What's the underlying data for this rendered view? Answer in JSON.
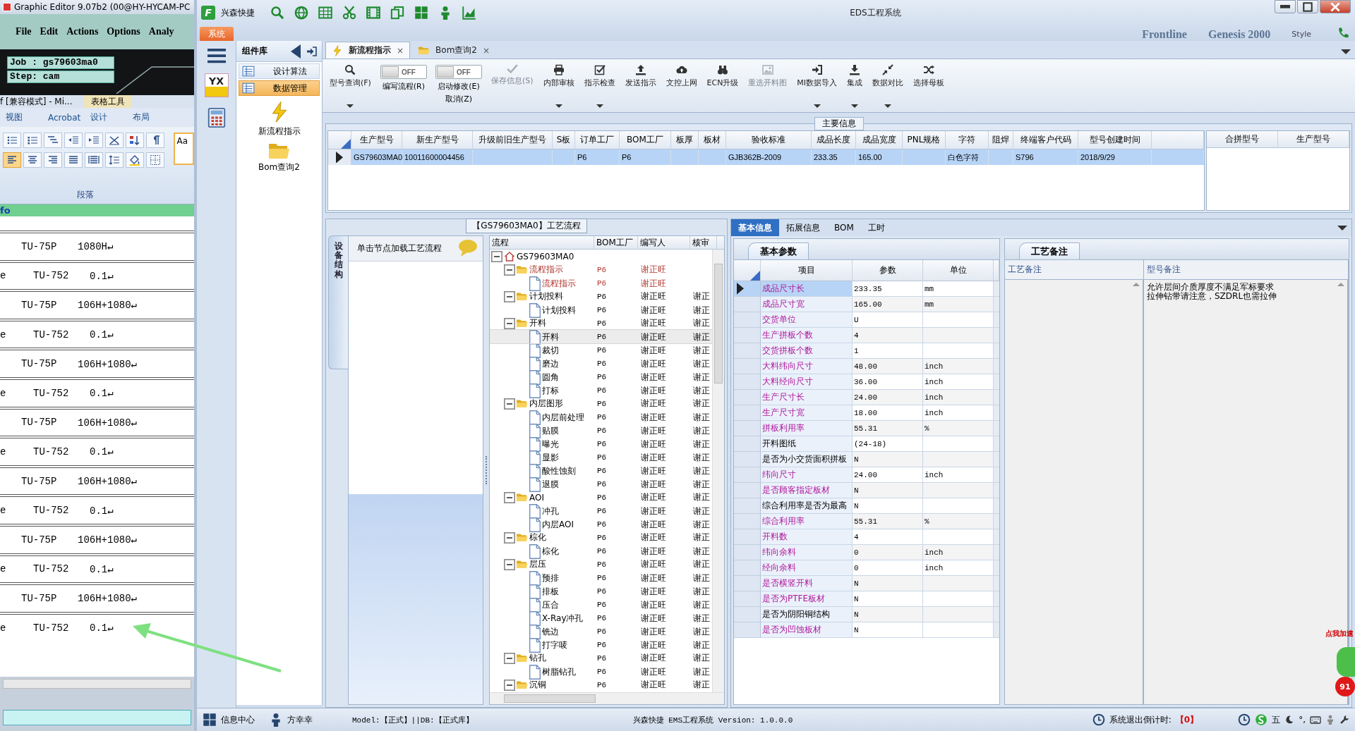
{
  "graphic_editor": {
    "title": "Graphic Editor 9.07b2 (00@HY-HYCAM-PC",
    "menu": [
      "File",
      "Edit",
      "Actions",
      "Options",
      "Analy"
    ],
    "job": "Job : gs79603ma0",
    "step": "Step: cam"
  },
  "word": {
    "title": "f [兼容模式] - Mi...",
    "context_tab": "表格工具",
    "tabs": [
      "视图",
      "Acrobat",
      "设计",
      "布局"
    ],
    "style_preview": "Aa",
    "group_label": "段落",
    "header_text": "fo",
    "lines": [
      {
        "code": "TU-75P",
        "value": "1080H↵"
      },
      {
        "prefix": "e",
        "code": "TU-752",
        "value": "0.1↵"
      },
      {
        "code": "TU-75P",
        "value": "106H+1080↵"
      },
      {
        "prefix": "e",
        "code": "TU-752",
        "value": "0.1↵"
      },
      {
        "code": "TU-75P",
        "value": "106H+1080↵"
      },
      {
        "prefix": "e",
        "code": "TU-752",
        "value": "0.1↵"
      },
      {
        "code": "TU-75P",
        "value": "106H+1080↵"
      },
      {
        "prefix": "e",
        "code": "TU-752",
        "value": "0.1↵"
      },
      {
        "code": "TU-75P",
        "value": "106H+1080↵"
      },
      {
        "prefix": "e",
        "code": "TU-752",
        "value": "0.1↵"
      },
      {
        "code": "TU-75P",
        "value": "106H+1080↵"
      },
      {
        "prefix": "e",
        "code": "TU-752",
        "value": "0.1↵"
      },
      {
        "code": "TU-75P",
        "value": "106H+1080↵"
      },
      {
        "prefix": "e",
        "code": "TU-752",
        "value": "0.1↵"
      }
    ]
  },
  "window": {
    "logo": "F",
    "app_name": "兴森快捷",
    "title": "EDS工程系统",
    "menu_tab": "系统",
    "ribbon_backdrop": [
      "Frontline",
      "Genesis 2000",
      "Style"
    ]
  },
  "nav": {
    "logo_text": "YX",
    "title": "组件库",
    "items": [
      {
        "label": "设计算法",
        "selected": false
      },
      {
        "label": "数据管理",
        "selected": true
      }
    ],
    "launchers": [
      {
        "kind": "lightning",
        "label": "新流程指示"
      },
      {
        "kind": "folder",
        "label": "Bom查询2"
      }
    ]
  },
  "doc_tabs": [
    {
      "kind": "lightning",
      "label": "新流程指示",
      "close": "×",
      "selected": true
    },
    {
      "kind": "folder",
      "label": "Bom查询2",
      "close": "×",
      "selected": false
    }
  ],
  "toolbar": {
    "items": [
      {
        "kind": "search",
        "label": "型号查询(F)",
        "disabled": false,
        "dropdown": true
      },
      {
        "kind": "toggle",
        "state_text": "OFF",
        "on": false,
        "label": "编写流程(R)"
      },
      {
        "kind": "toggle",
        "state_text": "OFF",
        "on": false,
        "label": "启动修改(E)",
        "sublabel": "取消(Z)"
      },
      {
        "kind": "check",
        "label": "保存信息(S)",
        "disabled": true,
        "dropdown": false
      },
      {
        "kind": "printer",
        "label": "内部审核",
        "disabled": false,
        "dropdown": true
      },
      {
        "kind": "checkbox",
        "label": "指示检查",
        "disabled": false,
        "dropdown": true
      },
      {
        "kind": "upload",
        "label": "发送指示",
        "disabled": false,
        "dropdown": false
      },
      {
        "kind": "cloud",
        "label": "文控上网",
        "disabled": false,
        "dropdown": false
      },
      {
        "kind": "binoculars",
        "label": "ECN升级",
        "disabled": false,
        "dropdown": false
      },
      {
        "kind": "picture",
        "label": "重选开料图",
        "disabled": true,
        "dropdown": false
      },
      {
        "kind": "import",
        "label": "MI数据导入",
        "disabled": false,
        "dropdown": true
      },
      {
        "kind": "download",
        "label": "集成",
        "disabled": false,
        "dropdown": true
      },
      {
        "kind": "merge",
        "label": "数据对比",
        "disabled": false,
        "dropdown": true
      },
      {
        "kind": "shuffle",
        "label": "选择母板",
        "disabled": false,
        "dropdown": false
      }
    ]
  },
  "main_info": {
    "title": "主要信息",
    "columns": [
      "生产型号",
      "新生产型号",
      "升级前旧生产型号",
      "S板",
      "订单工厂",
      "BOM工厂",
      "板厚",
      "板材",
      "验收标准",
      "成品长度",
      "成品宽度",
      "PNL规格",
      "字符",
      "阻焊",
      "终端客户代码",
      "型号创建时间"
    ],
    "rows": [
      {
        "selected": true,
        "cells": [
          "GS79603MA0",
          "10011600004456",
          null,
          null,
          "P6",
          "P6",
          null,
          null,
          "GJB362B-2009",
          "233.35",
          "165.00",
          null,
          "白色字符",
          null,
          "S796",
          "2018/9/29"
        ]
      }
    ],
    "side_columns": [
      "合拼型号",
      "生产型号"
    ]
  },
  "process": {
    "title": "【GS79603MA0】工艺流程",
    "side_tab": "设备结构",
    "hint": "单击节点加载工艺流程",
    "columns": [
      "流程",
      "BOM工厂",
      "编写人",
      "核审"
    ],
    "tree": [
      {
        "kind": "root",
        "label": "GS79603MA0",
        "expanded": true,
        "selected": false,
        "flagged": false,
        "children": [
          {
            "kind": "folder",
            "label": "流程指示",
            "bom": "P6",
            "author": "谢正旺",
            "expanded": true,
            "selected": false,
            "flagged": true,
            "children": [
              {
                "kind": "file",
                "label": "流程指示",
                "bom": "P6",
                "author": "谢正旺",
                "selected": false,
                "flagged": true
              }
            ]
          },
          {
            "kind": "folder",
            "label": "计划投料",
            "bom": "P6",
            "author": "谢正旺",
            "reviewer": "谢正",
            "expanded": true,
            "selected": false,
            "flagged": false,
            "children": [
              {
                "kind": "file",
                "label": "计划投料",
                "bom": "P6",
                "author": "谢正旺",
                "reviewer": "谢正",
                "selected": false,
                "flagged": false
              }
            ]
          },
          {
            "kind": "folder",
            "label": "开料",
            "bom": "P6",
            "author": "谢正旺",
            "reviewer": "谢正",
            "expanded": true,
            "selected": false,
            "flagged": false,
            "children": [
              {
                "kind": "file",
                "label": "开料",
                "bom": "P6",
                "author": "谢正旺",
                "reviewer": "谢正",
                "selected": true,
                "flagged": false
              },
              {
                "kind": "file",
                "label": "裁切",
                "bom": "P6",
                "author": "谢正旺",
                "reviewer": "谢正",
                "selected": false,
                "flagged": false
              },
              {
                "kind": "file",
                "label": "磨边",
                "bom": "P6",
                "author": "谢正旺",
                "reviewer": "谢正",
                "selected": false,
                "flagged": false
              },
              {
                "kind": "file",
                "label": "圆角",
                "bom": "P6",
                "author": "谢正旺",
                "reviewer": "谢正",
                "selected": false,
                "flagged": false
              },
              {
                "kind": "file",
                "label": "打标",
                "bom": "P6",
                "author": "谢正旺",
                "reviewer": "谢正",
                "selected": false,
                "flagged": false
              }
            ]
          },
          {
            "kind": "folder",
            "label": "内层图形",
            "bom": "P6",
            "author": "谢正旺",
            "reviewer": "谢正",
            "expanded": true,
            "selected": false,
            "flagged": false,
            "children": [
              {
                "kind": "file",
                "label": "内层前处理",
                "bom": "P6",
                "author": "谢正旺",
                "reviewer": "谢正",
                "selected": false,
                "flagged": false
              },
              {
                "kind": "file",
                "label": "贴膜",
                "bom": "P6",
                "author": "谢正旺",
                "reviewer": "谢正",
                "selected": false,
                "flagged": false
              },
              {
                "kind": "file",
                "label": "曝光",
                "bom": "P6",
                "author": "谢正旺",
                "reviewer": "谢正",
                "selected": false,
                "flagged": false
              },
              {
                "kind": "file",
                "label": "显影",
                "bom": "P6",
                "author": "谢正旺",
                "reviewer": "谢正",
                "selected": false,
                "flagged": false
              },
              {
                "kind": "file",
                "label": "酸性蚀刻",
                "bom": "P6",
                "author": "谢正旺",
                "reviewer": "谢正",
                "selected": false,
                "flagged": false
              },
              {
                "kind": "file",
                "label": "退膜",
                "bom": "P6",
                "author": "谢正旺",
                "reviewer": "谢正",
                "selected": false,
                "flagged": false
              }
            ]
          },
          {
            "kind": "folder",
            "label": "AOI",
            "bom": "P6",
            "author": "谢正旺",
            "reviewer": "谢正",
            "expanded": true,
            "selected": false,
            "flagged": false,
            "children": [
              {
                "kind": "file",
                "label": "冲孔",
                "bom": "P6",
                "author": "谢正旺",
                "reviewer": "谢正",
                "selected": false,
                "flagged": false
              },
              {
                "kind": "file",
                "label": "内层AOI",
                "bom": "P6",
                "author": "谢正旺",
                "reviewer": "谢正",
                "selected": false,
                "flagged": false
              }
            ]
          },
          {
            "kind": "folder",
            "label": "棕化",
            "bom": "P6",
            "author": "谢正旺",
            "reviewer": "谢正",
            "expanded": true,
            "selected": false,
            "flagged": false,
            "children": [
              {
                "kind": "file",
                "label": "棕化",
                "bom": "P6",
                "author": "谢正旺",
                "reviewer": "谢正",
                "selected": false,
                "flagged": false
              }
            ]
          },
          {
            "kind": "folder",
            "label": "层压",
            "bom": "P6",
            "author": "谢正旺",
            "reviewer": "谢正",
            "expanded": true,
            "selected": false,
            "flagged": false,
            "children": [
              {
                "kind": "file",
                "label": "预排",
                "bom": "P6",
                "author": "谢正旺",
                "reviewer": "谢正",
                "selected": false,
                "flagged": false
              },
              {
                "kind": "file",
                "label": "排板",
                "bom": "P6",
                "author": "谢正旺",
                "reviewer": "谢正",
                "selected": false,
                "flagged": false
              },
              {
                "kind": "file",
                "label": "压合",
                "bom": "P6",
                "author": "谢正旺",
                "reviewer": "谢正",
                "selected": false,
                "flagged": false
              },
              {
                "kind": "file",
                "label": "X-Ray冲孔",
                "bom": "P6",
                "author": "谢正旺",
                "reviewer": "谢正",
                "selected": false,
                "flagged": false
              },
              {
                "kind": "file",
                "label": "铣边",
                "bom": "P6",
                "author": "谢正旺",
                "reviewer": "谢正",
                "selected": false,
                "flagged": false
              },
              {
                "kind": "file",
                "label": "打字唛",
                "bom": "P6",
                "author": "谢正旺",
                "reviewer": "谢正",
                "selected": false,
                "flagged": false
              }
            ]
          },
          {
            "kind": "folder",
            "label": "钻孔",
            "bom": "P6",
            "author": "谢正旺",
            "reviewer": "谢正",
            "expanded": true,
            "selected": false,
            "flagged": false,
            "children": [
              {
                "kind": "file",
                "label": "树脂钻孔",
                "bom": "P6",
                "author": "谢正旺",
                "reviewer": "谢正",
                "selected": false,
                "flagged": false
              }
            ]
          },
          {
            "kind": "folder",
            "label": "沉铜",
            "bom": "P6",
            "author": "谢正旺",
            "reviewer": "谢正",
            "expanded": true,
            "selected": false,
            "flagged": false
          }
        ]
      }
    ]
  },
  "details": {
    "tabs": [
      {
        "label": "基本信息",
        "selected": true
      },
      {
        "label": "拓展信息",
        "selected": false
      },
      {
        "label": "BOM",
        "selected": false
      },
      {
        "label": "工时",
        "selected": false
      }
    ],
    "params": {
      "title": "基本参数",
      "columns": [
        "项目",
        "参数",
        "单位"
      ],
      "rows": [
        {
          "name": "成品尺寸长",
          "value": "233.35",
          "unit": "mm",
          "emphasized": true,
          "selected": true
        },
        {
          "name": "成品尺寸宽",
          "value": "165.00",
          "unit": "mm",
          "emphasized": true,
          "selected": false
        },
        {
          "name": "交货单位",
          "value": "U",
          "emphasized": true,
          "selected": false
        },
        {
          "name": "生产拼板个数",
          "value": "4",
          "emphasized": true,
          "selected": false
        },
        {
          "name": "交货拼板个数",
          "value": "1",
          "emphasized": true,
          "selected": false
        },
        {
          "name": "大料纬向尺寸",
          "value": "48.00",
          "unit": "inch",
          "emphasized": true,
          "selected": false
        },
        {
          "name": "大料经向尺寸",
          "value": "36.00",
          "unit": "inch",
          "emphasized": true,
          "selected": false
        },
        {
          "name": "生产尺寸长",
          "value": "24.00",
          "unit": "inch",
          "emphasized": true,
          "selected": false
        },
        {
          "name": "生产尺寸宽",
          "value": "18.00",
          "unit": "inch",
          "emphasized": true,
          "selected": false
        },
        {
          "name": "拼板利用率",
          "value": "55.31",
          "unit": "%",
          "emphasized": true,
          "selected": false
        },
        {
          "name": "开料图纸",
          "value": "(24-18)",
          "emphasized": false,
          "selected": false
        },
        {
          "name": "是否为小交货面积拼板",
          "value": "N",
          "emphasized": false,
          "selected": false
        },
        {
          "name": "纬向尺寸",
          "value": "24.00",
          "unit": "inch",
          "emphasized": true,
          "selected": false
        },
        {
          "name": "是否顾客指定板材",
          "value": "N",
          "emphasized": true,
          "selected": false
        },
        {
          "name": "综合利用率是否为最高",
          "value": "N",
          "emphasized": false,
          "selected": false
        },
        {
          "name": "综合利用率",
          "value": "55.31",
          "unit": "%",
          "emphasized": true,
          "selected": false
        },
        {
          "name": "开料数",
          "value": "4",
          "emphasized": true,
          "selected": false
        },
        {
          "name": "纬向余料",
          "value": "0",
          "unit": "inch",
          "emphasized": true,
          "selected": false
        },
        {
          "name": "经向余料",
          "value": "0",
          "unit": "inch",
          "emphasized": true,
          "selected": false
        },
        {
          "name": "是否横竖开料",
          "value": "N",
          "emphasized": true,
          "selected": false
        },
        {
          "name": "是否为PTFE板材",
          "value": "N",
          "emphasized": true,
          "selected": false
        },
        {
          "name": "是否为阴阳铜结构",
          "value": "N",
          "emphasized": false,
          "selected": false
        },
        {
          "name": "是否为凹蚀板材",
          "value": "N",
          "emphasized": true,
          "selected": false
        }
      ]
    },
    "remarks": {
      "title": "工艺备注",
      "columns": [
        "工艺备注",
        "型号备注"
      ],
      "model_note_lines": [
        "允许层间介质厚度不满足军标要求",
        "拉伸钻带请注意，SZDRL也需拉伸"
      ]
    }
  },
  "status_bar": {
    "info_center": "信息中心",
    "user": "方幸幸",
    "model": "Model:【正式】||DB:【正式库】",
    "version": "兴森快捷 EMS工程系统 Version: 1.0.0.0",
    "countdown_label": "系统退出倒计时:",
    "countdown": "【0】",
    "ime": "五",
    "punctuation": "°,"
  },
  "speed_widget": {
    "label": "点我加速",
    "badge": "91"
  }
}
